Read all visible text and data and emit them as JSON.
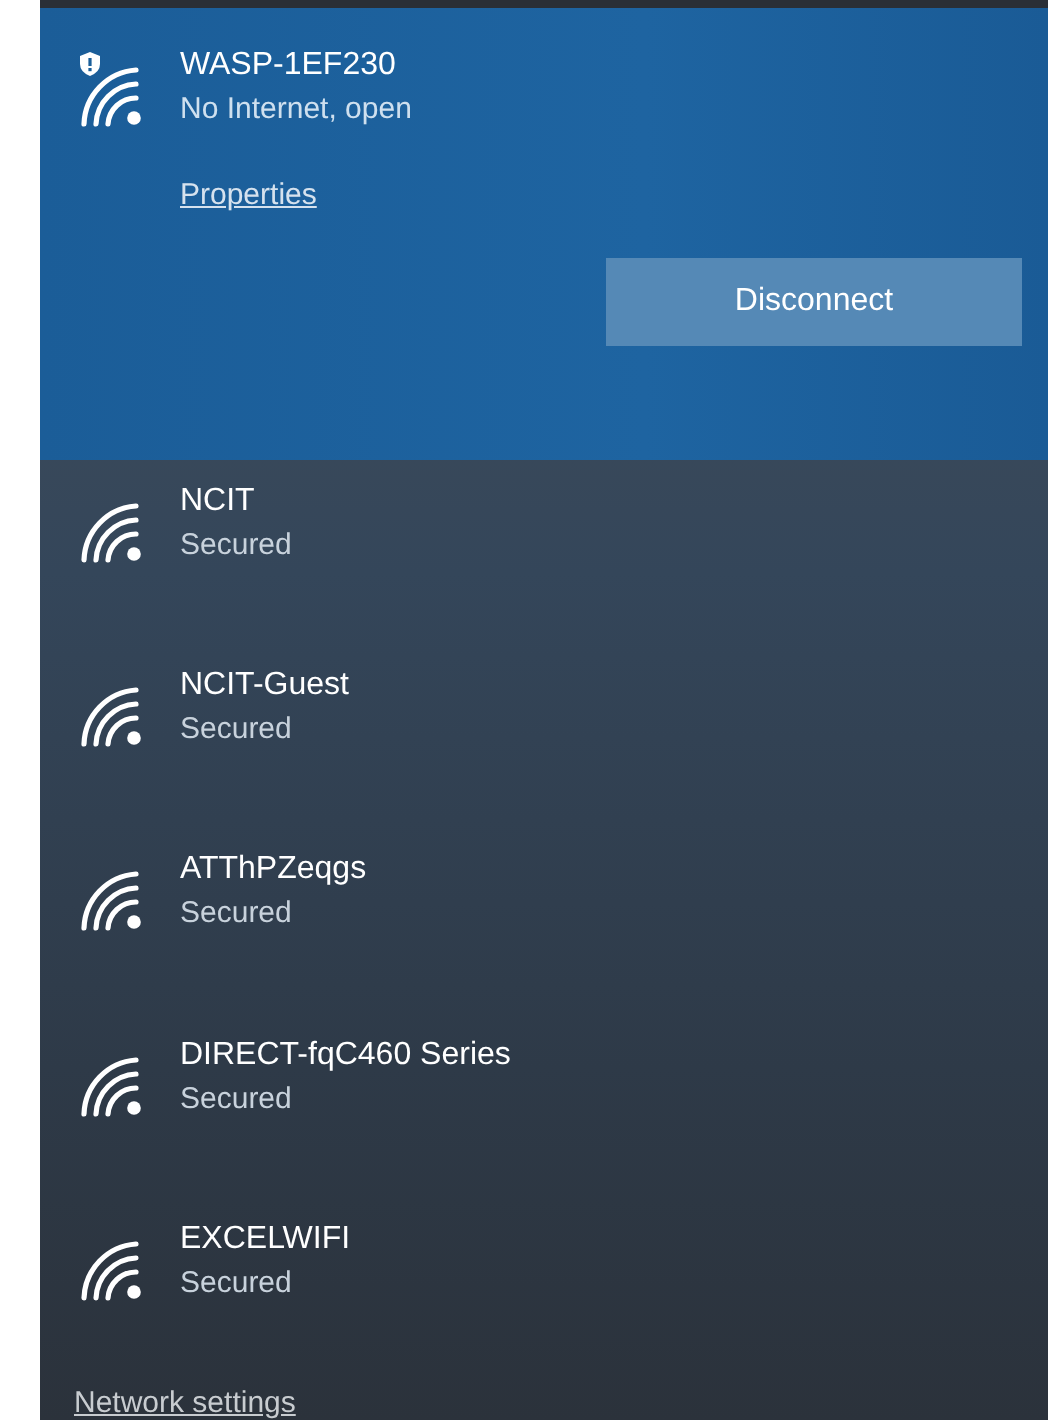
{
  "connected": {
    "name": "WASP-1EF230",
    "status": "No Internet, open",
    "shield": true,
    "link": "Properties",
    "button": "Disconnect"
  },
  "networks": [
    {
      "name": "NCIT",
      "status": "Secured",
      "shield": false
    },
    {
      "name": "NCIT-Guest",
      "status": "Secured",
      "shield": false
    },
    {
      "name": "ATThPZeqgs",
      "status": "Secured",
      "shield": false
    },
    {
      "name": "DIRECT-fqC460 Series",
      "status": "Secured",
      "shield": false
    },
    {
      "name": "EXCELWIFI",
      "status": "Secured",
      "shield": false
    }
  ],
  "footer_link": "Network settings"
}
